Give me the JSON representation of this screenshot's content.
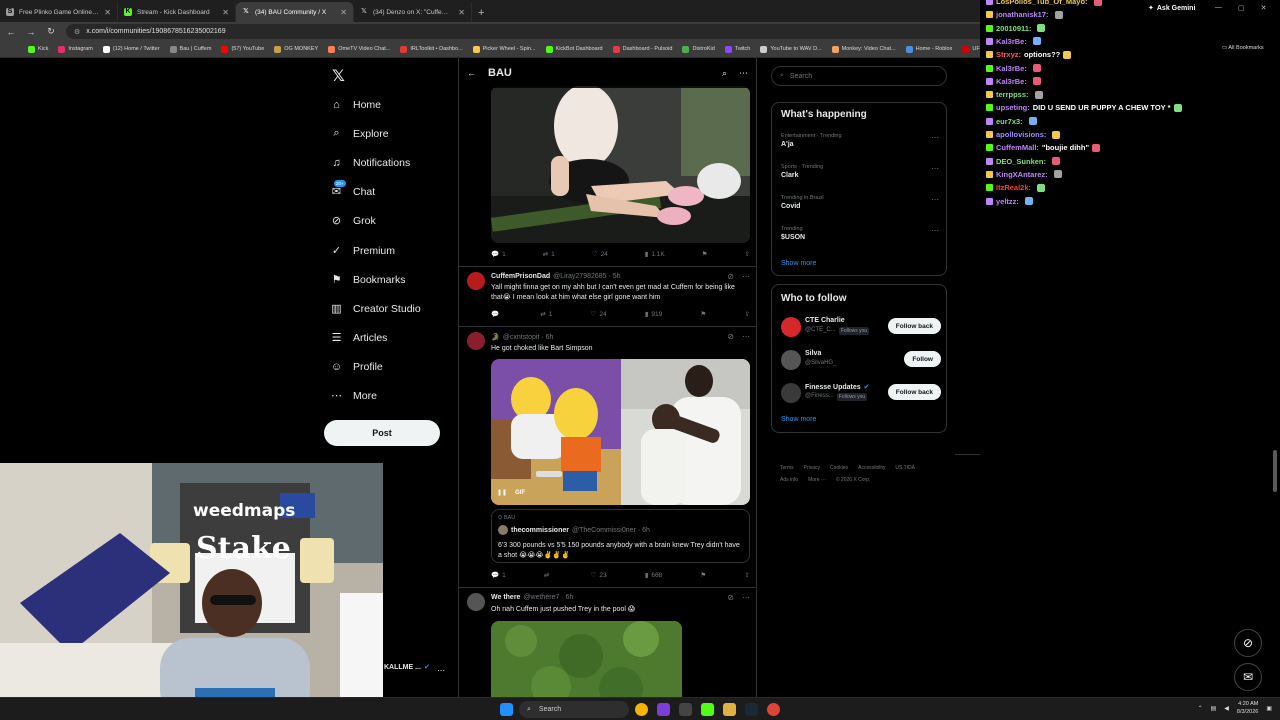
{
  "browser": {
    "tabs": [
      {
        "title": "Free Plinko Game Online - Play",
        "color": "#9e9e9e",
        "glyph": "S"
      },
      {
        "title": "Stream - Kick Dashboard",
        "color": "#53fc18",
        "glyph": "K"
      },
      {
        "title": "(34) BAU Community / X",
        "color": "#ffffff",
        "glyph": "X"
      },
      {
        "title": "(34) Denzo on X: \"Cuffem throw",
        "color": "#ffffff",
        "glyph": "X"
      }
    ],
    "url": "x.com/i/communities/1908678516235002169",
    "ask_gemini": "Ask Gemini",
    "all_bookmarks": "All Bookmarks",
    "bookmarks": [
      {
        "label": "Kick",
        "color": "#53fc18"
      },
      {
        "label": "Instagram",
        "color": "#e1306c"
      },
      {
        "label": "(12) Home / Twitter",
        "color": "#ffffff"
      },
      {
        "label": "Bau | Cuffem",
        "color": "#888888"
      },
      {
        "label": "(57) YouTube",
        "color": "#ff0000"
      },
      {
        "label": "OG MONKEY",
        "color": "#c8a04a"
      },
      {
        "label": "OmeTV Video Chat...",
        "color": "#ff7f50"
      },
      {
        "label": "IRLToolkit • Dashbo...",
        "color": "#e53935"
      },
      {
        "label": "Picker Wheel - Spin...",
        "color": "#f9c74f"
      },
      {
        "label": "KickBot Dashboard",
        "color": "#53fc18"
      },
      {
        "label": "Dashboard - Pulsoid",
        "color": "#e63946"
      },
      {
        "label": "DistroKid",
        "color": "#4caf50"
      },
      {
        "label": "Twitch",
        "color": "#9146ff"
      },
      {
        "label": "YouTube to WAV D...",
        "color": "#cccccc"
      },
      {
        "label": "Monkey: Video Chat...",
        "color": "#f4a261"
      },
      {
        "label": "Home - Roblox",
        "color": "#4a90e2"
      },
      {
        "label": "UFC 326: Holloway...",
        "color": "#d00000"
      }
    ]
  },
  "nav": {
    "items": [
      {
        "label": "Home",
        "icon": "⌂"
      },
      {
        "label": "Explore",
        "icon": "⌕"
      },
      {
        "label": "Notifications",
        "icon": "♫"
      },
      {
        "label": "Chat",
        "icon": "✉"
      },
      {
        "label": "Grok",
        "icon": "⊘"
      },
      {
        "label": "Premium",
        "icon": "✓"
      },
      {
        "label": "Bookmarks",
        "icon": "⚑"
      },
      {
        "label": "Creator Studio",
        "icon": "▥"
      },
      {
        "label": "Articles",
        "icon": "☰"
      },
      {
        "label": "Profile",
        "icon": "☺"
      },
      {
        "label": "More",
        "icon": "⋯"
      }
    ],
    "chat_badge": "20+",
    "post_label": "Post"
  },
  "feed": {
    "title": "BAU",
    "post1_actions": {
      "replies": "1",
      "reposts": "1",
      "likes": "24",
      "views": "1.1K"
    },
    "post2": {
      "name": "CuffemPrisonDad",
      "handle": "@Liray27982685 · 5h",
      "text": "Yall might finna get on my ahh but I can't even get mad at Cuffem for being like that😭 I mean look at him what else girl gone want him",
      "actions": {
        "replies": "",
        "reposts": "1",
        "likes": "24",
        "views": "919"
      }
    },
    "post3": {
      "name": "🐊",
      "handle": "@cxntstopit · 6h",
      "text": "He got choked like Bart Simpson",
      "gif_label": "GIF",
      "quote_context": "BAU",
      "quote_name": "thecommissioner",
      "quote_handle": "@TheCommissi0ner · 6h",
      "quote_text": "6'3 300 pounds vs 5'5 150 pounds anybody with a brain knew Trey didn't have a shot 😭😭😭✌️✌️✌️",
      "actions": {
        "replies": "1",
        "reposts": "",
        "likes": "23",
        "views": "668"
      }
    },
    "post4": {
      "name": "We there",
      "handle": "@wethere7 · 6h",
      "text": "Oh nah Cuffem just pushed Trey in the pool 😱"
    }
  },
  "sidebar": {
    "search_placeholder": "Search",
    "happening_title": "What's happening",
    "trends": [
      {
        "category": "Entertainment · Trending",
        "name": "A'ja"
      },
      {
        "category": "Sports · Trending",
        "name": "Clark"
      },
      {
        "category": "Trending in Brazil",
        "name": "Covid"
      },
      {
        "category": "Trending",
        "name": "$USON"
      }
    ],
    "show_more": "Show more",
    "follow_title": "Who to follow",
    "who": [
      {
        "name": "CTE Charlie",
        "handle": "@CTE_C...",
        "follows_you": "Follows you",
        "button": "Follow back",
        "color": "#d62828"
      },
      {
        "name": "Silva",
        "handle": "@SilvaHG_",
        "follows_you": "",
        "button": "Follow",
        "color": "#555555"
      },
      {
        "name": "Finesse Updates",
        "handle": "@Finess...",
        "follows_you": "Follows you",
        "button": "Follow back",
        "color": "#3a3a3a"
      }
    ],
    "footer_links": [
      "Terms",
      "Privacy",
      "Cookies",
      "Accessibility",
      "US TIDA",
      "Ads info",
      "More ···",
      "© 2026 X Corp."
    ]
  },
  "chat": {
    "lines": [
      {
        "user": "LosPollos_Tub_Of_Mayo:",
        "msg": "",
        "color": "#f2c94c"
      },
      {
        "user": "jonathanisk17:",
        "msg": "",
        "color": "#c084fc"
      },
      {
        "user": "20010911:",
        "msg": "",
        "color": "#7ee081"
      },
      {
        "user": "Kal3rBe:",
        "msg": "",
        "color": "#c084fc"
      },
      {
        "user": "Strxyz:",
        "msg": "options??",
        "color": "#ff5a5a"
      },
      {
        "user": "Kal3rBe:",
        "msg": "",
        "color": "#c084fc"
      },
      {
        "user": "Kal3rBe:",
        "msg": "",
        "color": "#c084fc"
      },
      {
        "user": "terrppss:",
        "msg": "",
        "color": "#7ee081"
      },
      {
        "user": "upseting:",
        "msg": "DID U SEND UR PUPPY A CHEW TOY *",
        "color": "#c084fc"
      },
      {
        "user": "eur7x3:",
        "msg": "",
        "color": "#7ee081"
      },
      {
        "user": "apollovisions:",
        "msg": "",
        "color": "#9b8cff"
      },
      {
        "user": "CuffemMall:",
        "msg": "\"boujie dihh\"",
        "color": "#c084fc"
      },
      {
        "user": "DEO_Sunken:",
        "msg": "",
        "color": "#7ee081"
      },
      {
        "user": "KingXAntarez:",
        "msg": "",
        "color": "#c084fc"
      },
      {
        "user": "ItzReal2k:",
        "msg": "",
        "color": "#ff3b3b"
      },
      {
        "user": "yeltzz:",
        "msg": "",
        "color": "#c084fc"
      }
    ]
  },
  "webcam": {
    "banner_top": "weedmaps",
    "banner_main": "Stake",
    "label": "KALLME ..."
  },
  "taskbar": {
    "search_placeholder": "Search",
    "time": "4:20 AM",
    "date": "8/3/2026"
  }
}
